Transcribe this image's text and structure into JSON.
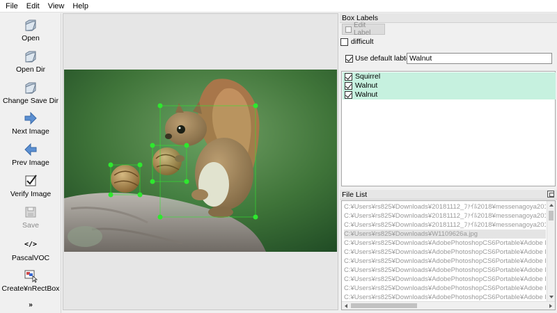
{
  "menu": [
    "File",
    "Edit",
    "View",
    "Help"
  ],
  "tools": [
    {
      "label": "Open",
      "icon": "open-folder-icon",
      "enabled": true
    },
    {
      "label": "Open Dir",
      "icon": "open-dir-icon",
      "enabled": true
    },
    {
      "label": "Change Save Dir",
      "icon": "change-save-dir-icon",
      "enabled": true
    },
    {
      "label": "Next Image",
      "icon": "next-arrow-icon",
      "enabled": true
    },
    {
      "label": "Prev Image",
      "icon": "prev-arrow-icon",
      "enabled": true
    },
    {
      "label": "Verify Image",
      "icon": "verify-check-icon",
      "enabled": true
    },
    {
      "label": "Save",
      "icon": "save-disk-icon",
      "enabled": false
    },
    {
      "label": "PascalVOC",
      "icon": "code-tag-icon",
      "enabled": true,
      "icon_text": "</>"
    },
    {
      "label": "Create¥nRectBox",
      "icon": "create-rect-box-icon",
      "enabled": true
    }
  ],
  "more_glyph": "»",
  "box_labels": {
    "title": "Box Labels",
    "edit_label": "Edit Label",
    "difficult": {
      "label": "difficult",
      "checked": false
    },
    "use_default": {
      "label": "Use default labtel",
      "checked": true,
      "value": "Walnut"
    },
    "items": [
      {
        "label": "Squirrel",
        "checked": true
      },
      {
        "label": "Walnut",
        "checked": true
      },
      {
        "label": "Walnut",
        "checked": true
      }
    ],
    "highlight_color": "#c6f1df"
  },
  "file_list": {
    "title": "File List",
    "files": [
      "C:¥Users¥rs825¥Downloads¥20181112_ﾌｧｲﾙ2018¥messenagoya2018¥report¥ML",
      "C:¥Users¥rs825¥Downloads¥20181112_ﾌｧｲﾙ2018¥messenagoya2018¥report¥ML",
      "C:¥Users¥rs825¥Downloads¥20181112_ﾌｧｲﾙ2018¥messenagoya2018¥report¥ML",
      "C:¥Users¥rs825¥Downloads¥W1109626a.jpg",
      "C:¥Users¥rs825¥Downloads¥AdobePhotoshopCS6Portable¥Adobe Extensio",
      "C:¥Users¥rs825¥Downloads¥AdobePhotoshopCS6Portable¥Adobe Extensio",
      "C:¥Users¥rs825¥Downloads¥AdobePhotoshopCS6Portable¥Adobe Extensio",
      "C:¥Users¥rs825¥Downloads¥AdobePhotoshopCS6Portable¥Adobe Extensio",
      "C:¥Users¥rs825¥Downloads¥AdobePhotoshopCS6Portable¥Adobe Extensio",
      "C:¥Users¥rs825¥Downloads¥AdobePhotoshopCS6Portable¥Adobe Extensio",
      "C:¥Users¥rs825¥Downloads¥AdobePhotoshopCS6Portable¥Adobe Extensio",
      "C:¥Users¥rs825¥Downloads¥AdobePhotoshopCS6Portable¥MVTMLFRessu"
    ],
    "selected_index": 3
  },
  "annotations": {
    "box_color": "#2ee82e",
    "boxes": [
      {
        "label": "Squirrel"
      },
      {
        "label": "Walnut"
      },
      {
        "label": "Walnut"
      }
    ]
  }
}
